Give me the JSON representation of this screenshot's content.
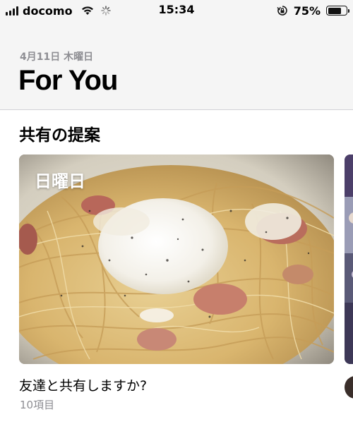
{
  "status_bar": {
    "carrier": "docomo",
    "time": "15:34",
    "battery_percent_text": "75%",
    "battery_level": 0.75
  },
  "header": {
    "date": "4月11日 木曜日",
    "title": "For You"
  },
  "section": {
    "title": "共有の提案"
  },
  "card": {
    "day_label": "日曜日",
    "caption": "友達と共有しますか?",
    "count": "10項目"
  },
  "icons": [
    "signal-icon",
    "wifi-icon",
    "activity-spinner-icon",
    "orientation-lock-icon",
    "battery-icon"
  ]
}
